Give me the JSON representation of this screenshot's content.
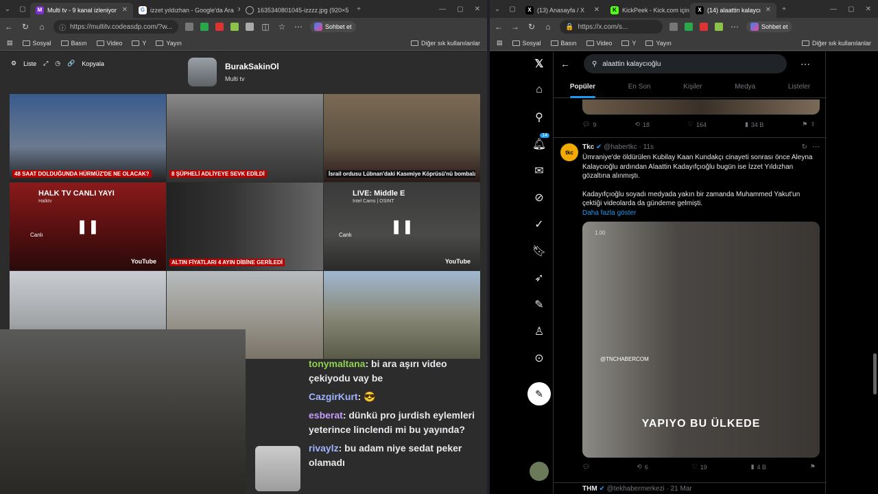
{
  "left_window": {
    "tabs": [
      {
        "label": "Multi tv - 9 kanal izleniyor",
        "icon": "multitv-icon",
        "active": true
      },
      {
        "label": "izzet yıldızhan - Google'da Ara",
        "icon": "google-icon",
        "active": false
      },
      {
        "label": "1635340801045-izzzz.jpg (920×5",
        "icon": "globe-icon",
        "active": false
      }
    ],
    "url": "https://multitv.codeasdp.com/?w...",
    "copilot_label": "Sohbet et",
    "bookmarks": [
      "Sosyal",
      "Basın",
      "Video",
      "Y",
      "Yayın"
    ],
    "bookmarks_other": "Diğer sık kullanılanlar"
  },
  "multitv": {
    "controls": {
      "list": "Liste",
      "copy": "Kopyala"
    },
    "user": {
      "name": "BurakSakinOl",
      "subtitle": "Multi tv"
    },
    "tiles": [
      {
        "ticker": "48 SAAT DOLDUĞUNDA HÜRMÜZ'DE NE OLACAK?"
      },
      {
        "ticker": "8 ŞÜPHELİ ADLİYEYE SEVK EDİLDİ"
      },
      {
        "ticker": "İsrail ordusu Lübnan'daki Kasımiye Köprüsü'nü bombaladı"
      },
      {
        "title": "HALK TV CANLI YAYI",
        "sub": "Halktv",
        "live": "Canlı",
        "yt": "YouTube"
      },
      {
        "ticker": "ALTIN FİYATLARI 4 AYIN DİBİNE GERİLEDİ"
      },
      {
        "title": "LIVE: Middle E",
        "sub": "Intel Cams | OSINT",
        "live": "Canlı",
        "yt": "YouTube"
      }
    ]
  },
  "chat": {
    "messages": [
      {
        "user": "tonymaltana",
        "text": "bi ara aşırı video çekiyodu vay be",
        "color": "#8fd14f"
      },
      {
        "user": "CazgirKurt",
        "text": "😎",
        "color": "#9fb4ff"
      },
      {
        "user": "esberat",
        "text": "dünkü pro jurdish eylemleri yeterince linclendi mi bu yayında?",
        "color": "#c79bff"
      },
      {
        "user": "rivaylz",
        "text": "bu adam niye sedat peker olamadı",
        "color": "#9fb4ff"
      }
    ]
  },
  "right_window": {
    "tabs": [
      {
        "label": "(13) Anasayfa / X",
        "icon": "x-icon",
        "active": false
      },
      {
        "label": "KickPeek - Kick.com için",
        "icon": "kick-icon",
        "active": false
      },
      {
        "label": "(14) alaattin kalaycı",
        "icon": "x-icon",
        "active": true
      }
    ],
    "url": "https://x.com/s...",
    "copilot_label": "Sohbet et",
    "bookmarks": [
      "Sosyal",
      "Basın",
      "Video",
      "Y",
      "Yayın"
    ],
    "bookmarks_other": "Diğer sık kullanılanlar"
  },
  "x": {
    "search_value": "alaattin kalaycıoğlu",
    "tabs": [
      "Popüler",
      "En Son",
      "Kişiler",
      "Medya",
      "Listeler"
    ],
    "notif_badge": "14",
    "prev_metrics": {
      "replies": "9",
      "reposts": "18",
      "likes": "164",
      "views": "34 B"
    },
    "tweet": {
      "name": "Tkc",
      "handle": "@habertkc",
      "time": "· 11s",
      "avatar_text": "tkc",
      "body1": "Ümraniye'de öldürülen Kubilay Kaan Kundakçı cinayeti sonrası önce Aleyna Kalaycıoğlu ardından Alaattin Kadayıfçıoğlu bugün ise İzzet Yıldızhan gözaltına alınmıştı.",
      "body2": "Kadayıfçıoğlu soyadı medyada yakın bir zamanda Muhammed Yakut'un çektiği videolarda da gündeme gelmişti.",
      "more": "Daha fazla göster",
      "media_caption": "YAPIYO BU ÜLKEDE",
      "media_watermark": "@TNCHABERCOM",
      "media_speed": "1.00",
      "metrics": {
        "replies": "",
        "reposts": "6",
        "likes": "19",
        "views": "4 B"
      }
    },
    "next_tweet": {
      "name": "THM",
      "handle": "@tekhabermerkezi · 21 Mar"
    }
  }
}
